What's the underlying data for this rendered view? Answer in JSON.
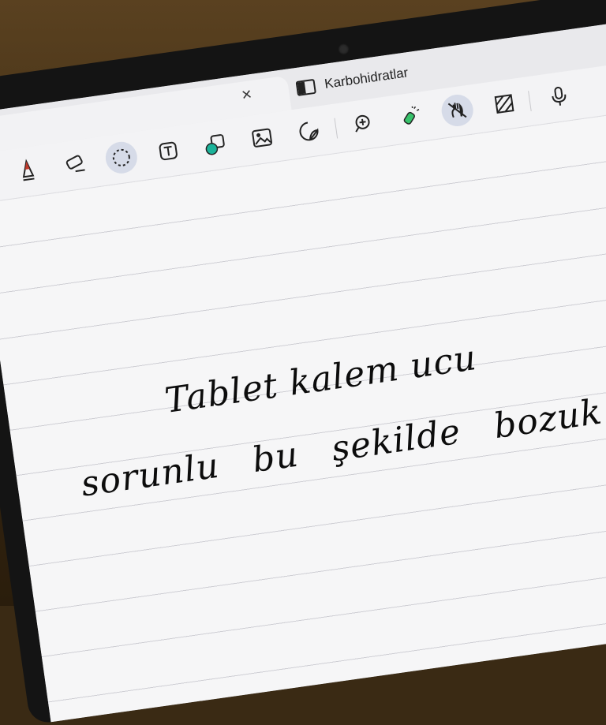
{
  "tab": {
    "close_glyph": "×",
    "title": "Karbohidratlar"
  },
  "toolbar": {
    "tools": [
      "pen",
      "eraser",
      "lasso",
      "text",
      "shapes",
      "image",
      "sticker",
      "zoom",
      "highlighter",
      "palm-rejection",
      "pattern",
      "microphone"
    ],
    "selected": "lasso"
  },
  "note": {
    "line1": "Tablet kalem ucu",
    "line2": "sorunlu bu şekilde bozuk yazıyor."
  }
}
